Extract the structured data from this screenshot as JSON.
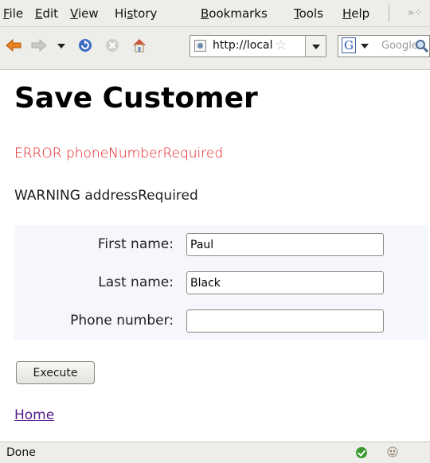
{
  "browser": {
    "menu": [
      {
        "pre": "",
        "u": "F",
        "post": "ile"
      },
      {
        "pre": "",
        "u": "E",
        "post": "dit"
      },
      {
        "pre": "",
        "u": "V",
        "post": "iew"
      },
      {
        "pre": "Hi",
        "u": "s",
        "post": "tory"
      },
      {
        "pre": "",
        "u": "B",
        "post": "ookmarks"
      },
      {
        "pre": "",
        "u": "T",
        "post": "ools"
      },
      {
        "pre": "",
        "u": "H",
        "post": "elp"
      }
    ],
    "overflow_label": "»",
    "url": "http://localhost",
    "search_placeholder": "Google",
    "colors": {
      "chrome": "#ededea",
      "accent_back": "#e8821e",
      "reload": "#3b6cc5",
      "home": "#c9553a"
    }
  },
  "page": {
    "title": "Save Customer",
    "error_message": "ERROR phoneNumberRequired",
    "warning_message": "WARNING addressRequired",
    "form": {
      "fields": [
        {
          "label": "First name:",
          "value": "Paul"
        },
        {
          "label": "Last name:",
          "value": "Black"
        },
        {
          "label": "Phone number:",
          "value": ""
        }
      ]
    },
    "execute_label": "Execute",
    "home_link": "Home",
    "colors": {
      "error": "#e8191c",
      "link_visited": "#551a8b",
      "form_bg": "#f5f7fc"
    }
  },
  "status": {
    "text": "Done"
  }
}
